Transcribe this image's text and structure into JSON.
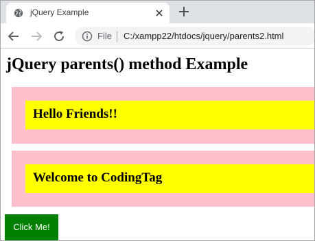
{
  "browser": {
    "tab_title": "jQuery Example",
    "omnibox": {
      "security_label": "File",
      "url": "C:/xampp22/htdocs/jquery/parents2.html"
    }
  },
  "page": {
    "heading": "jQuery parents() method Example",
    "boxes": [
      {
        "text": "Hello Friends!!"
      },
      {
        "text": "Welcome to CodingTag"
      }
    ],
    "button_label": "Click Me!"
  },
  "colors": {
    "outer_box": "#ffc0cb",
    "inner_box": "#ffff00",
    "button_bg": "#008000",
    "button_text": "#ffffff"
  }
}
